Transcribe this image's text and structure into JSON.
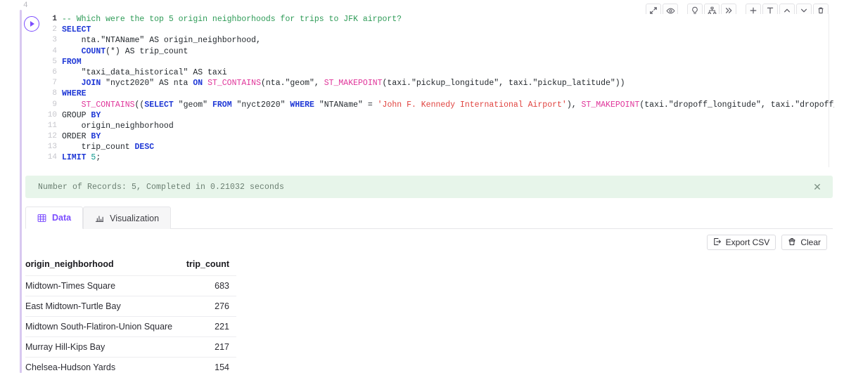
{
  "cell": {
    "index": "4",
    "run_button_label": "run-cell"
  },
  "toolbar": {
    "buttons": [
      {
        "name": "expand-icon",
        "title": "Expand"
      },
      {
        "name": "eye-icon",
        "title": "Preview"
      },
      {
        "name": "lightbulb-icon",
        "title": "Suggestions"
      },
      {
        "name": "sitemap-icon",
        "title": "Lineage"
      },
      {
        "name": "chevrons-right-icon",
        "title": "More"
      },
      {
        "name": "plus-icon",
        "title": "Add cell"
      },
      {
        "name": "format-text-icon",
        "title": "Format"
      },
      {
        "name": "chevron-up-icon",
        "title": "Move up"
      },
      {
        "name": "chevron-down-icon",
        "title": "Move down"
      },
      {
        "name": "trash-icon",
        "title": "Delete cell"
      }
    ]
  },
  "editor": {
    "lines": [
      {
        "n": "1",
        "tokens": [
          {
            "t": "-- Which were the top 5 origin neighborhoods for trips to JFK airport?",
            "c": "tk-com"
          }
        ]
      },
      {
        "n": "2",
        "tokens": [
          {
            "t": "SELECT",
            "c": "tk-kw"
          }
        ]
      },
      {
        "n": "3",
        "tokens": [
          {
            "t": "    nta.\"NTAName\" AS origin_neighborhood,",
            "c": "tk-op"
          }
        ]
      },
      {
        "n": "4",
        "tokens": [
          {
            "t": "    ",
            "c": "tk-op"
          },
          {
            "t": "COUNT",
            "c": "tk-kw"
          },
          {
            "t": "(*) AS trip_count",
            "c": "tk-op"
          }
        ]
      },
      {
        "n": "5",
        "tokens": [
          {
            "t": "FROM",
            "c": "tk-kw"
          }
        ]
      },
      {
        "n": "6",
        "tokens": [
          {
            "t": "    \"taxi_data_historical\" AS taxi",
            "c": "tk-op"
          }
        ]
      },
      {
        "n": "7",
        "tokens": [
          {
            "t": "    ",
            "c": "tk-op"
          },
          {
            "t": "JOIN",
            "c": "tk-kw"
          },
          {
            "t": " \"nyct2020\" AS nta ",
            "c": "tk-op"
          },
          {
            "t": "ON",
            "c": "tk-kw"
          },
          {
            "t": " ",
            "c": "tk-op"
          },
          {
            "t": "ST_CONTAINS",
            "c": "tk-fn"
          },
          {
            "t": "(nta.\"geom\", ",
            "c": "tk-op"
          },
          {
            "t": "ST_MAKEPOINT",
            "c": "tk-fn"
          },
          {
            "t": "(taxi.\"pickup_longitude\", taxi.\"pickup_latitude\"))",
            "c": "tk-op"
          }
        ]
      },
      {
        "n": "8",
        "tokens": [
          {
            "t": "WHERE",
            "c": "tk-kw"
          }
        ]
      },
      {
        "n": "9",
        "tokens": [
          {
            "t": "    ",
            "c": "tk-op"
          },
          {
            "t": "ST_CONTAINS",
            "c": "tk-fn"
          },
          {
            "t": "((",
            "c": "tk-op"
          },
          {
            "t": "SELECT",
            "c": "tk-kw"
          },
          {
            "t": " \"geom\" ",
            "c": "tk-op"
          },
          {
            "t": "FROM",
            "c": "tk-kw"
          },
          {
            "t": " \"nyct2020\" ",
            "c": "tk-op"
          },
          {
            "t": "WHERE",
            "c": "tk-kw"
          },
          {
            "t": " \"NTAName\" = ",
            "c": "tk-op"
          },
          {
            "t": "'John F. Kennedy International Airport'",
            "c": "tk-str"
          },
          {
            "t": "), ",
            "c": "tk-op"
          },
          {
            "t": "ST_MAKEPOINT",
            "c": "tk-fn"
          },
          {
            "t": "(taxi.\"dropoff_longitude\", taxi.\"dropoff_latitude\"))",
            "c": "tk-op"
          }
        ]
      },
      {
        "n": "10",
        "tokens": [
          {
            "t": "GROUP ",
            "c": "tk-op"
          },
          {
            "t": "BY",
            "c": "tk-kw"
          }
        ]
      },
      {
        "n": "11",
        "tokens": [
          {
            "t": "    origin_neighborhood",
            "c": "tk-op"
          }
        ]
      },
      {
        "n": "12",
        "tokens": [
          {
            "t": "ORDER ",
            "c": "tk-op"
          },
          {
            "t": "BY",
            "c": "tk-kw"
          }
        ]
      },
      {
        "n": "13",
        "tokens": [
          {
            "t": "    trip_count ",
            "c": "tk-op"
          },
          {
            "t": "DESC",
            "c": "tk-kw"
          }
        ]
      },
      {
        "n": "14",
        "tokens": [
          {
            "t": "LIMIT ",
            "c": "tk-kw"
          },
          {
            "t": "5",
            "c": "tk-num"
          },
          {
            "t": ";",
            "c": "tk-op"
          }
        ]
      }
    ]
  },
  "banner": {
    "text": "Number of Records: 5, Completed in 0.21032 seconds",
    "close_label": "✕",
    "background": "#e7f5ea"
  },
  "results": {
    "tabs": [
      {
        "label": "Data",
        "icon": "grid-icon",
        "active": true
      },
      {
        "label": "Visualization",
        "icon": "bar-chart-icon",
        "active": false
      }
    ],
    "actions": [
      {
        "label": "Export CSV",
        "icon": "export-icon"
      },
      {
        "label": "Clear",
        "icon": "broom-icon"
      }
    ],
    "table": {
      "columns": [
        "origin_neighborhood",
        "trip_count"
      ],
      "rows": [
        [
          "Midtown-Times Square",
          "683"
        ],
        [
          "East Midtown-Turtle Bay",
          "276"
        ],
        [
          "Midtown South-Flatiron-Union Square",
          "221"
        ],
        [
          "Murray Hill-Kips Bay",
          "217"
        ],
        [
          "Chelsea-Hudson Yards",
          "154"
        ]
      ]
    }
  },
  "theme": {
    "accent": "#7c4dff",
    "keyword": "#1f38d6",
    "comment": "#2e9b57",
    "function": "#e0359a",
    "string": "#e0433f",
    "number": "#11998e"
  }
}
